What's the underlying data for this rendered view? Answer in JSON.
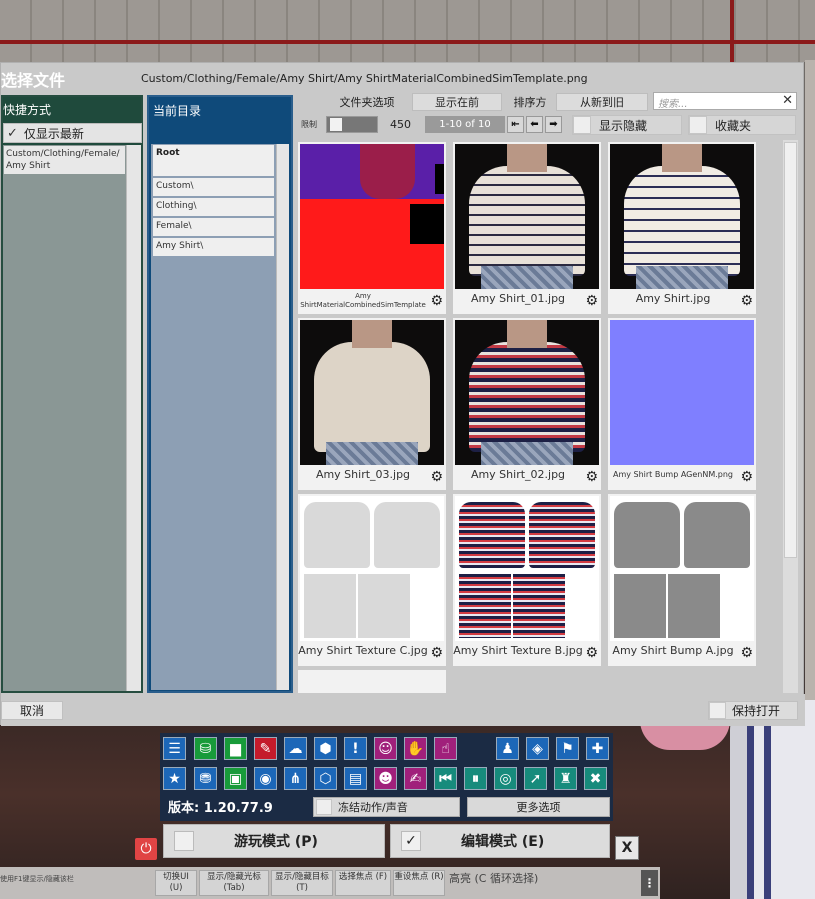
{
  "dialog": {
    "title": "选择文件",
    "path": "Custom/Clothing/Female/Amy Shirt/Amy ShirtMaterialCombinedSimTemplate.png",
    "shortcuts_header": "快捷方式",
    "show_latest_label": "仅显示最新",
    "shortcut_item": "Custom/Clothing/Female/ Amy Shirt",
    "current_dir_header": "当前目录",
    "dirs": [
      "Root",
      "Custom\\",
      "Clothing\\",
      "Female\\",
      "Amy Shirt\\"
    ],
    "folder_options_label": "文件夹选项",
    "show_first_btn": "显示在前",
    "sort_label": "排序方",
    "sort_btn": "从新到旧",
    "search_placeholder": "搜索...",
    "limit_label": "限制",
    "limit_value": "450",
    "pager": "1-10 of 10",
    "show_hidden": "显示隐藏",
    "favorites": "收藏夹",
    "files": [
      "Amy ShirtMaterialCombinedSimTemplate",
      "Amy Shirt_01.jpg",
      "Amy Shirt.jpg",
      "Amy Shirt_03.jpg",
      "Amy Shirt_02.jpg",
      "Amy Shirt Bump AGenNM.png",
      "Amy Shirt Texture C.jpg",
      "Amy Shirt Texture B.jpg",
      "Amy Shirt Bump A.jpg"
    ],
    "cancel": "取消",
    "keep_open": "保持打开"
  },
  "toolbar": {
    "version": "版本: 1.20.77.9",
    "freeze": "冻结动作/声音",
    "more_options": "更多选项",
    "play_mode": "游玩模式 (P)",
    "edit_mode": "编辑模式 (E)",
    "close": "X"
  },
  "hints": {
    "left": "使用F1键显示/隐藏该栏",
    "btn1": "切换UI (U)",
    "btn2": "显示/隐藏光标 (Tab)",
    "btn3": "显示/隐藏目标 (T)",
    "btn4": "选择焦点 (F)",
    "btn5": "重设焦点 (R)",
    "text": "高亮 (C 循环选择)"
  },
  "icons": {
    "gear": "gear-icon",
    "checkmark": "check-icon",
    "power": "power-icon"
  },
  "colors": {
    "shortcuts_bg": "#1f4a3c",
    "curdir_bg": "#0f4a7a",
    "toolbar_bg": "#1b2b44",
    "normal_map": "#7f7fff"
  }
}
